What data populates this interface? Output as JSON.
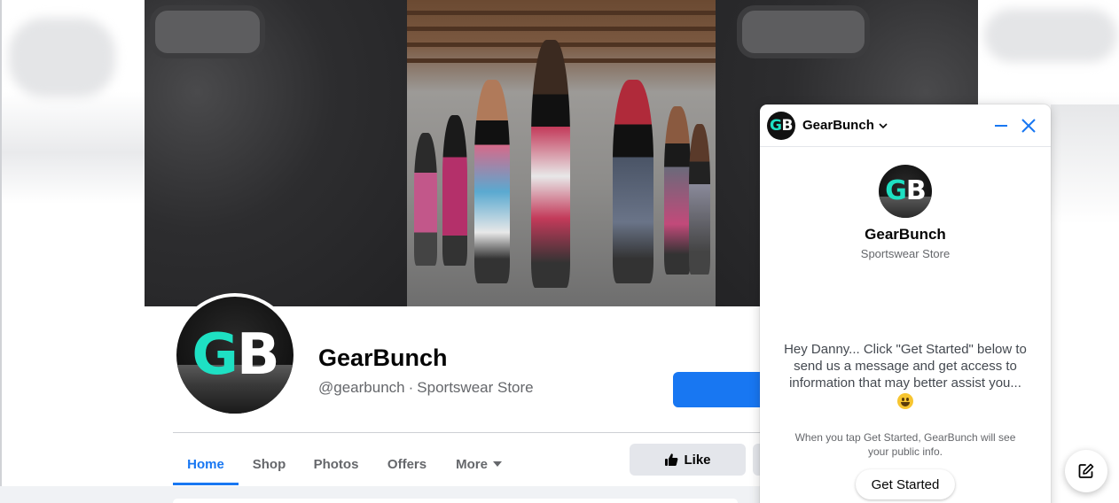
{
  "page": {
    "name": "GearBunch",
    "handle": "@gearbunch",
    "separator": "·",
    "category": "Sportswear Store",
    "logo_g": "G",
    "logo_b": "B"
  },
  "tabs": [
    {
      "label": "Home",
      "active": true
    },
    {
      "label": "Shop",
      "active": false
    },
    {
      "label": "Photos",
      "active": false
    },
    {
      "label": "Offers",
      "active": false
    },
    {
      "label": "More",
      "active": false
    }
  ],
  "actions": {
    "like_label": "Like"
  },
  "chat": {
    "header_name": "GearBunch",
    "title": "GearBunch",
    "subtitle": "Sportswear Store",
    "greeting": "Hey Danny... Click \"Get Started\" below to send us a message and get access to information that may better assist you...",
    "notice": "When you tap Get Started, GearBunch will see your public info.",
    "get_started_label": "Get Started"
  },
  "icons": {
    "chevron": "chevron-down-icon",
    "minimize": "minimize-icon",
    "close": "close-icon",
    "like": "thumbs-up-icon",
    "compose": "compose-icon",
    "caret": "caret-down-icon",
    "emoji": "grinning-face-icon"
  },
  "colors": {
    "brand_blue": "#1877f2",
    "logo_teal": "#1ee0c3",
    "text_secondary": "#65676b"
  }
}
